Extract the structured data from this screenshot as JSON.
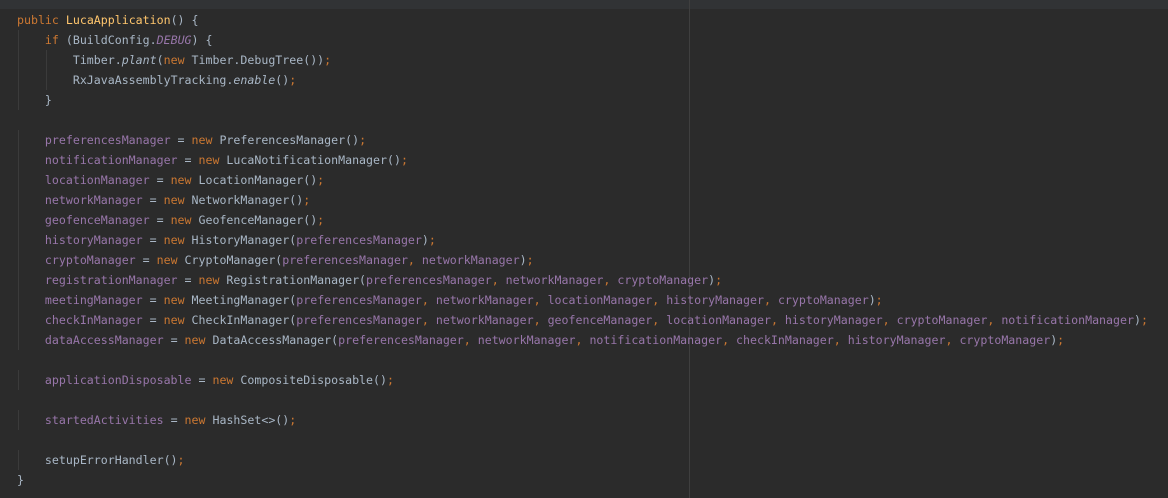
{
  "editor": {
    "language": "java",
    "colors": {
      "background": "#2b2b2b",
      "keyword": "#cc7832",
      "method_declaration": "#ffc66d",
      "field": "#9876aa",
      "text": "#a9b7c6"
    },
    "lines": [
      {
        "indent": 0,
        "tokens": [
          {
            "t": "public",
            "c": "kw"
          },
          {
            "t": " ",
            "c": "plain"
          },
          {
            "t": "LucaApplication",
            "c": "mth"
          },
          {
            "t": "() {",
            "c": "plain"
          }
        ]
      },
      {
        "indent": 1,
        "tokens": [
          {
            "t": "if",
            "c": "kw"
          },
          {
            "t": " (BuildConfig.",
            "c": "plain"
          },
          {
            "t": "DEBUG",
            "c": "stfld"
          },
          {
            "t": ") {",
            "c": "plain"
          }
        ]
      },
      {
        "indent": 2,
        "tokens": [
          {
            "t": "Timber.",
            "c": "plain"
          },
          {
            "t": "plant",
            "c": "st"
          },
          {
            "t": "(",
            "c": "plain"
          },
          {
            "t": "new",
            "c": "kw"
          },
          {
            "t": " Timber.DebugTree())",
            "c": "plain"
          },
          {
            "t": ";",
            "c": "kw"
          }
        ]
      },
      {
        "indent": 2,
        "tokens": [
          {
            "t": "RxJavaAssemblyTracking.",
            "c": "plain"
          },
          {
            "t": "enable",
            "c": "st"
          },
          {
            "t": "()",
            "c": "plain"
          },
          {
            "t": ";",
            "c": "kw"
          }
        ]
      },
      {
        "indent": 1,
        "tokens": [
          {
            "t": "}",
            "c": "plain"
          }
        ]
      },
      {
        "indent": 0,
        "tokens": []
      },
      {
        "indent": 1,
        "tokens": [
          {
            "t": "preferencesManager",
            "c": "fld"
          },
          {
            "t": " = ",
            "c": "plain"
          },
          {
            "t": "new",
            "c": "kw"
          },
          {
            "t": " PreferencesManager()",
            "c": "plain"
          },
          {
            "t": ";",
            "c": "kw"
          }
        ]
      },
      {
        "indent": 1,
        "tokens": [
          {
            "t": "notificationManager",
            "c": "fld"
          },
          {
            "t": " = ",
            "c": "plain"
          },
          {
            "t": "new",
            "c": "kw"
          },
          {
            "t": " LucaNotificationManager()",
            "c": "plain"
          },
          {
            "t": ";",
            "c": "kw"
          }
        ]
      },
      {
        "indent": 1,
        "tokens": [
          {
            "t": "locationManager",
            "c": "fld"
          },
          {
            "t": " = ",
            "c": "plain"
          },
          {
            "t": "new",
            "c": "kw"
          },
          {
            "t": " LocationManager()",
            "c": "plain"
          },
          {
            "t": ";",
            "c": "kw"
          }
        ]
      },
      {
        "indent": 1,
        "tokens": [
          {
            "t": "networkManager",
            "c": "fld"
          },
          {
            "t": " = ",
            "c": "plain"
          },
          {
            "t": "new",
            "c": "kw"
          },
          {
            "t": " NetworkManager()",
            "c": "plain"
          },
          {
            "t": ";",
            "c": "kw"
          }
        ]
      },
      {
        "indent": 1,
        "tokens": [
          {
            "t": "geofenceManager",
            "c": "fld"
          },
          {
            "t": " = ",
            "c": "plain"
          },
          {
            "t": "new",
            "c": "kw"
          },
          {
            "t": " GeofenceManager()",
            "c": "plain"
          },
          {
            "t": ";",
            "c": "kw"
          }
        ]
      },
      {
        "indent": 1,
        "tokens": [
          {
            "t": "historyManager",
            "c": "fld"
          },
          {
            "t": " = ",
            "c": "plain"
          },
          {
            "t": "new",
            "c": "kw"
          },
          {
            "t": " HistoryManager(",
            "c": "plain"
          },
          {
            "t": "preferencesManager",
            "c": "fld"
          },
          {
            "t": ")",
            "c": "plain"
          },
          {
            "t": ";",
            "c": "kw"
          }
        ]
      },
      {
        "indent": 1,
        "tokens": [
          {
            "t": "cryptoManager",
            "c": "fld"
          },
          {
            "t": " = ",
            "c": "plain"
          },
          {
            "t": "new",
            "c": "kw"
          },
          {
            "t": " CryptoManager(",
            "c": "plain"
          },
          {
            "t": "preferencesManager",
            "c": "fld"
          },
          {
            "t": ", ",
            "c": "kw"
          },
          {
            "t": "networkManager",
            "c": "fld"
          },
          {
            "t": ")",
            "c": "plain"
          },
          {
            "t": ";",
            "c": "kw"
          }
        ]
      },
      {
        "indent": 1,
        "tokens": [
          {
            "t": "registrationManager",
            "c": "fld"
          },
          {
            "t": " = ",
            "c": "plain"
          },
          {
            "t": "new",
            "c": "kw"
          },
          {
            "t": " RegistrationManager(",
            "c": "plain"
          },
          {
            "t": "preferencesManager",
            "c": "fld"
          },
          {
            "t": ", ",
            "c": "kw"
          },
          {
            "t": "networkManager",
            "c": "fld"
          },
          {
            "t": ", ",
            "c": "kw"
          },
          {
            "t": "cryptoManager",
            "c": "fld"
          },
          {
            "t": ")",
            "c": "plain"
          },
          {
            "t": ";",
            "c": "kw"
          }
        ]
      },
      {
        "indent": 1,
        "tokens": [
          {
            "t": "meetingManager",
            "c": "fld"
          },
          {
            "t": " = ",
            "c": "plain"
          },
          {
            "t": "new",
            "c": "kw"
          },
          {
            "t": " MeetingManager(",
            "c": "plain"
          },
          {
            "t": "preferencesManager",
            "c": "fld"
          },
          {
            "t": ", ",
            "c": "kw"
          },
          {
            "t": "networkManager",
            "c": "fld"
          },
          {
            "t": ", ",
            "c": "kw"
          },
          {
            "t": "locationManager",
            "c": "fld"
          },
          {
            "t": ", ",
            "c": "kw"
          },
          {
            "t": "historyManager",
            "c": "fld"
          },
          {
            "t": ", ",
            "c": "kw"
          },
          {
            "t": "cryptoManager",
            "c": "fld"
          },
          {
            "t": ")",
            "c": "plain"
          },
          {
            "t": ";",
            "c": "kw"
          }
        ]
      },
      {
        "indent": 1,
        "tokens": [
          {
            "t": "checkInManager",
            "c": "fld"
          },
          {
            "t": " = ",
            "c": "plain"
          },
          {
            "t": "new",
            "c": "kw"
          },
          {
            "t": " CheckInManager(",
            "c": "plain"
          },
          {
            "t": "preferencesManager",
            "c": "fld"
          },
          {
            "t": ", ",
            "c": "kw"
          },
          {
            "t": "networkManager",
            "c": "fld"
          },
          {
            "t": ", ",
            "c": "kw"
          },
          {
            "t": "geofenceManager",
            "c": "fld"
          },
          {
            "t": ", ",
            "c": "kw"
          },
          {
            "t": "locationManager",
            "c": "fld"
          },
          {
            "t": ", ",
            "c": "kw"
          },
          {
            "t": "historyManager",
            "c": "fld"
          },
          {
            "t": ", ",
            "c": "kw"
          },
          {
            "t": "cryptoManager",
            "c": "fld"
          },
          {
            "t": ", ",
            "c": "kw"
          },
          {
            "t": "notificationManager",
            "c": "fld"
          },
          {
            "t": ")",
            "c": "plain"
          },
          {
            "t": ";",
            "c": "kw"
          }
        ]
      },
      {
        "indent": 1,
        "tokens": [
          {
            "t": "dataAccessManager",
            "c": "fld"
          },
          {
            "t": " = ",
            "c": "plain"
          },
          {
            "t": "new",
            "c": "kw"
          },
          {
            "t": " DataAccessManager(",
            "c": "plain"
          },
          {
            "t": "preferencesManager",
            "c": "fld"
          },
          {
            "t": ", ",
            "c": "kw"
          },
          {
            "t": "networkManager",
            "c": "fld"
          },
          {
            "t": ", ",
            "c": "kw"
          },
          {
            "t": "notificationManager",
            "c": "fld"
          },
          {
            "t": ", ",
            "c": "kw"
          },
          {
            "t": "checkInManager",
            "c": "fld"
          },
          {
            "t": ", ",
            "c": "kw"
          },
          {
            "t": "historyManager",
            "c": "fld"
          },
          {
            "t": ", ",
            "c": "kw"
          },
          {
            "t": "cryptoManager",
            "c": "fld"
          },
          {
            "t": ")",
            "c": "plain"
          },
          {
            "t": ";",
            "c": "kw"
          }
        ]
      },
      {
        "indent": 0,
        "tokens": []
      },
      {
        "indent": 1,
        "tokens": [
          {
            "t": "applicationDisposable",
            "c": "fld"
          },
          {
            "t": " = ",
            "c": "plain"
          },
          {
            "t": "new",
            "c": "kw"
          },
          {
            "t": " CompositeDisposable()",
            "c": "plain"
          },
          {
            "t": ";",
            "c": "kw"
          }
        ]
      },
      {
        "indent": 0,
        "tokens": []
      },
      {
        "indent": 1,
        "tokens": [
          {
            "t": "startedActivities",
            "c": "fld"
          },
          {
            "t": " = ",
            "c": "plain"
          },
          {
            "t": "new",
            "c": "kw"
          },
          {
            "t": " HashSet<>()",
            "c": "plain"
          },
          {
            "t": ";",
            "c": "kw"
          }
        ]
      },
      {
        "indent": 0,
        "tokens": []
      },
      {
        "indent": 1,
        "tokens": [
          {
            "t": "setupErrorHandler()",
            "c": "plain"
          },
          {
            "t": ";",
            "c": "kw"
          }
        ]
      },
      {
        "indent": 0,
        "tokens": [
          {
            "t": "}",
            "c": "plain"
          }
        ]
      }
    ]
  }
}
